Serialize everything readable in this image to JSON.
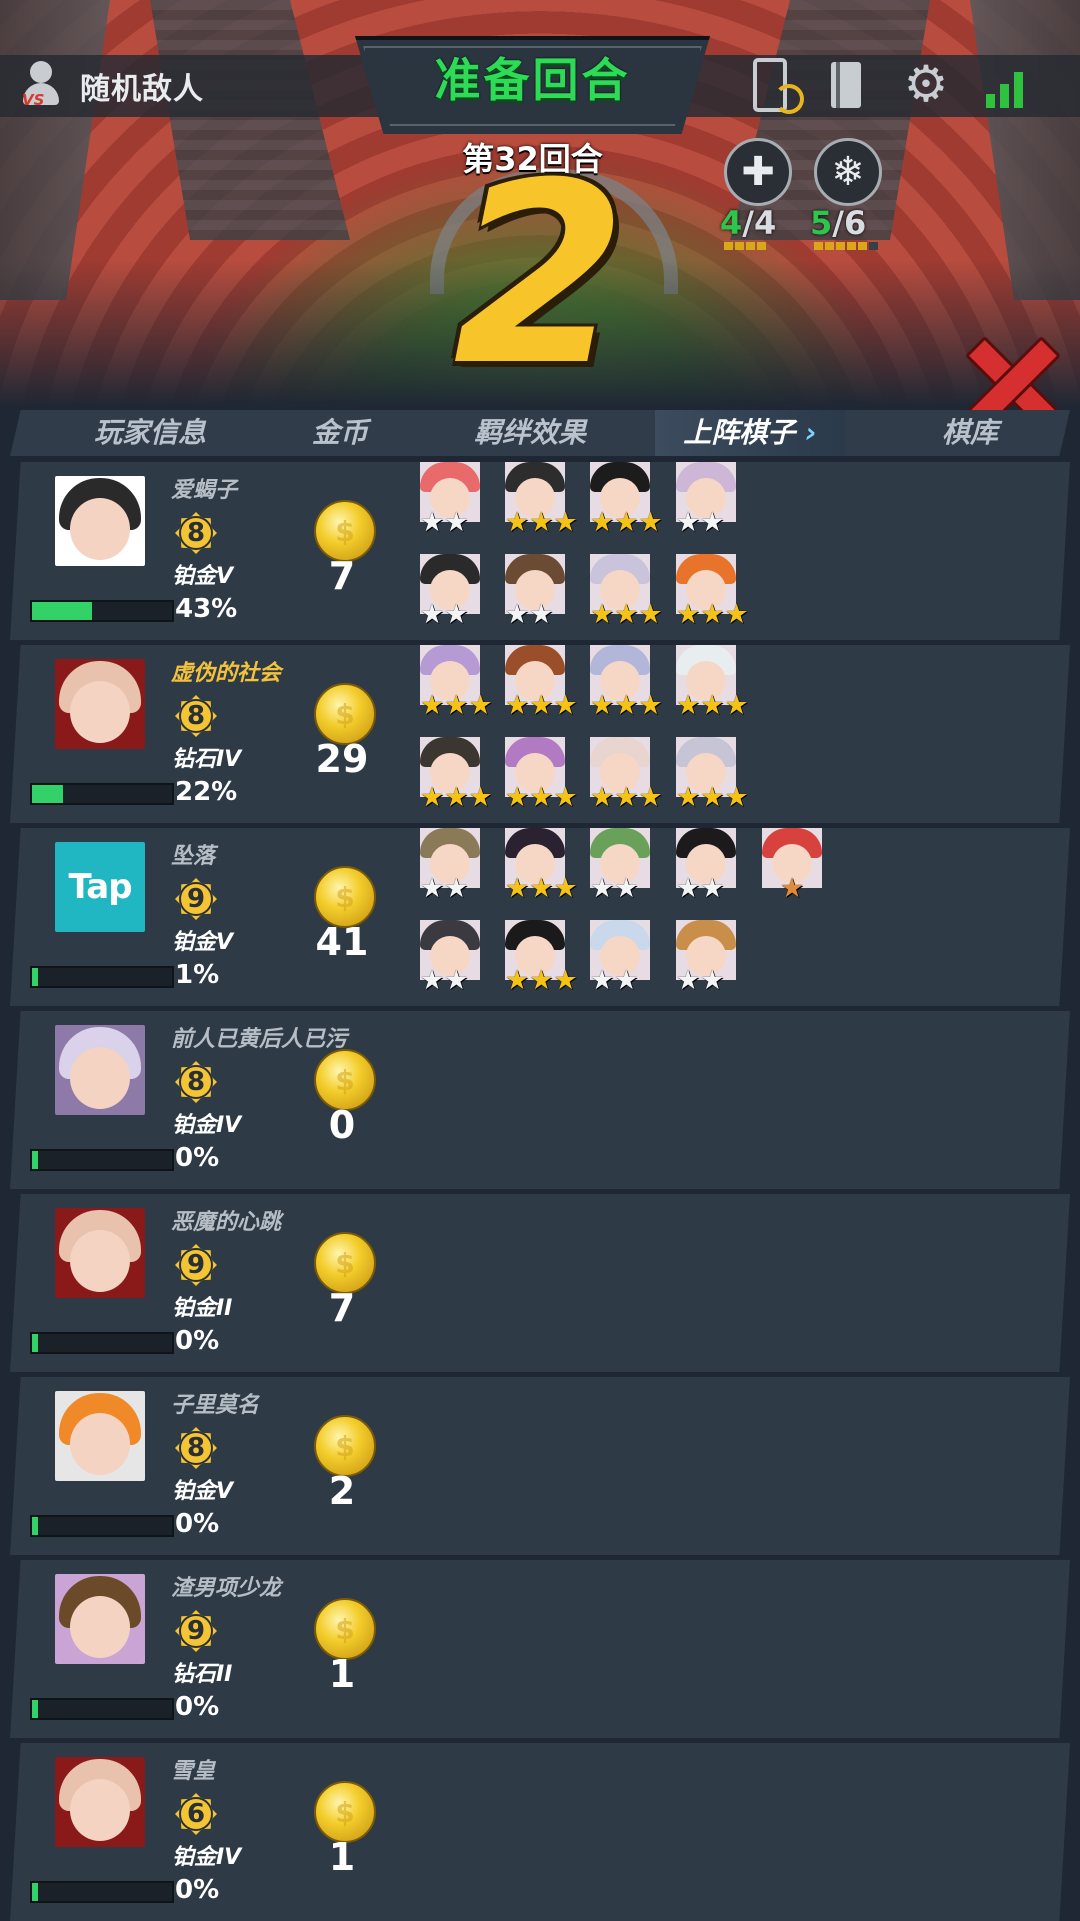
{
  "header": {
    "enemy_label": "随机敌人",
    "phase_title": "准备回合",
    "round_label": "第32回合",
    "countdown": "2"
  },
  "top_icons": [
    "phone-sync-icon",
    "book-icon",
    "gear-icon",
    "signal-icon"
  ],
  "synergies": [
    {
      "icon": "cross-icon",
      "current": "4",
      "max": "/4"
    },
    {
      "icon": "snowflake-icon",
      "current": "5",
      "max": "/6"
    }
  ],
  "tabs": [
    {
      "label": "玩家信息"
    },
    {
      "label": "金币"
    },
    {
      "label": "羁绊效果"
    },
    {
      "label": "上阵棋子",
      "chevron": "›"
    },
    {
      "label": "棋库"
    }
  ],
  "players": [
    {
      "name": "爱蝎子",
      "level": "8",
      "rank": "铂金V",
      "xp": "43%",
      "xp_fraction": 0.43,
      "gold": "7",
      "name_color": "#b6bdc5",
      "avatar_hair": "#2a2a2a",
      "avatar_bg": "#ffffff",
      "units": [
        {
          "hair": "#e86a6a",
          "stars": 2,
          "tier": "silver"
        },
        {
          "hair": "#2d2d2d",
          "stars": 3,
          "tier": "gold"
        },
        {
          "hair": "#1c1c1c",
          "stars": 3,
          "tier": "gold"
        },
        {
          "hair": "#cdb6d6",
          "stars": 2,
          "tier": "silver"
        },
        {
          "hair": "#2a2a2a",
          "stars": 2,
          "tier": "silver"
        },
        {
          "hair": "#6b4b33",
          "stars": 2,
          "tier": "silver"
        },
        {
          "hair": "#c9c3dc",
          "stars": 3,
          "tier": "gold"
        },
        {
          "hair": "#e8742b",
          "stars": 3,
          "tier": "gold"
        }
      ]
    },
    {
      "name": "虚伪的社会",
      "level": "8",
      "rank": "钻石IV",
      "xp": "22%",
      "xp_fraction": 0.22,
      "gold": "29",
      "name_color": "#f2c23a",
      "avatar_hair": "#e8c2ad",
      "avatar_bg": "#8a1a1a",
      "units": [
        {
          "hair": "#b69ad4",
          "stars": 3,
          "tier": "gold"
        },
        {
          "hair": "#9a4e2a",
          "stars": 3,
          "tier": "gold"
        },
        {
          "hair": "#b2b7da",
          "stars": 3,
          "tier": "gold"
        },
        {
          "hair": "#e8eef0",
          "stars": 3,
          "tier": "gold"
        },
        {
          "hair": "#3b3630",
          "stars": 3,
          "tier": "gold"
        },
        {
          "hair": "#b27ac2",
          "stars": 3,
          "tier": "gold"
        },
        {
          "hair": "#e8d5cf",
          "stars": 3,
          "tier": "gold"
        },
        {
          "hair": "#c7c4d6",
          "stars": 3,
          "tier": "gold"
        }
      ]
    },
    {
      "name": "坠落",
      "level": "9",
      "rank": "铂金V",
      "xp": "1%",
      "xp_fraction": 0.01,
      "gold": "41",
      "name_color": "#b6bdc5",
      "avatar_tap": "Tap",
      "units": [
        {
          "hair": "#8a7a58",
          "stars": 2,
          "tier": "silver"
        },
        {
          "hair": "#2a2230",
          "stars": 3,
          "tier": "gold"
        },
        {
          "hair": "#6aa15a",
          "stars": 2,
          "tier": "silver"
        },
        {
          "hair": "#1c1a1a",
          "stars": 2,
          "tier": "silver"
        },
        {
          "hair": "#d8423e",
          "stars": 1,
          "tier": "bronze"
        },
        {
          "hair": "#3a3a40",
          "stars": 2,
          "tier": "silver"
        },
        {
          "hair": "#1a1a1a",
          "stars": 3,
          "tier": "gold"
        },
        {
          "hair": "#c9d8ea",
          "stars": 2,
          "tier": "silver"
        },
        {
          "hair": "#c98e4a",
          "stars": 2,
          "tier": "silver"
        }
      ]
    },
    {
      "name": "前人已黄后人已污",
      "level": "8",
      "rank": "铂金IV",
      "xp": "0%",
      "xp_fraction": 0.0,
      "gold": "0",
      "name_color": "#b6bdc5",
      "avatar_hair": "#d9d2ea",
      "avatar_bg": "#8e7aa8",
      "units": []
    },
    {
      "name": "恶魔的心跳",
      "level": "9",
      "rank": "铂金II",
      "xp": "0%",
      "xp_fraction": 0.0,
      "gold": "7",
      "name_color": "#b6bdc5",
      "avatar_hair": "#e8c2ad",
      "avatar_bg": "#8a1a1a",
      "units": []
    },
    {
      "name": "子里莫名",
      "level": "8",
      "rank": "铂金V",
      "xp": "0%",
      "xp_fraction": 0.0,
      "gold": "2",
      "name_color": "#b6bdc5",
      "avatar_hair": "#f08a28",
      "avatar_bg": "#e6e6e6",
      "units": []
    },
    {
      "name": "渣男项少龙",
      "level": "9",
      "rank": "钻石II",
      "xp": "0%",
      "xp_fraction": 0.0,
      "gold": "1",
      "name_color": "#b6bdc5",
      "avatar_hair": "#6b4a2a",
      "avatar_bg": "#c9a4d4",
      "units": []
    },
    {
      "name": "雪皇",
      "level": "6",
      "rank": "铂金IV",
      "xp": "0%",
      "xp_fraction": 0.0,
      "gold": "1",
      "name_color": "#b6bdc5",
      "avatar_hair": "#e8c2ad",
      "avatar_bg": "#8a1a1a",
      "units": []
    }
  ]
}
